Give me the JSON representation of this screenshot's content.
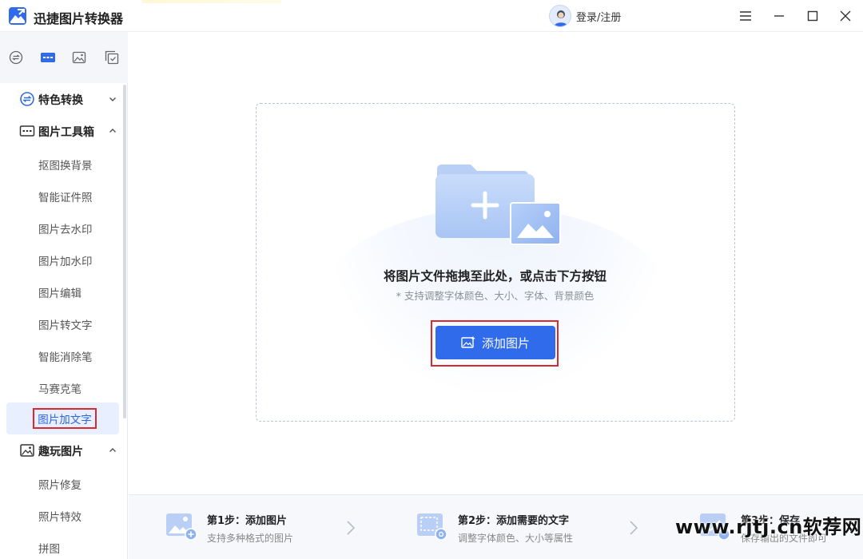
{
  "app": {
    "title": "迅捷图片转换器",
    "login_label": "登录/注册"
  },
  "sidebar": {
    "categories": [
      {
        "label": "特色转换"
      },
      {
        "label": "图片工具箱"
      },
      {
        "label": "趣玩图片"
      }
    ],
    "toolbox_items": [
      "抠图换背景",
      "智能证件照",
      "图片去水印",
      "图片加水印",
      "图片编辑",
      "图片转文字",
      "智能消除笔",
      "马赛克笔",
      "图片加文字"
    ],
    "fun_items": [
      "照片修复",
      "照片特效",
      "拼图"
    ],
    "active_item": "图片加文字"
  },
  "dropzone": {
    "title": "将图片文件拖拽至此处，或点击下方按钮",
    "subtitle": "* 支持调整字体颜色、大小、字体、背景颜色",
    "add_button": "添加图片"
  },
  "steps": [
    {
      "title": "第1步：添加图片",
      "desc": "支持多种格式的图片"
    },
    {
      "title": "第2步：添加需要的文字",
      "desc": "调整字体颜色、大小等属性"
    },
    {
      "title": "第3步：保存",
      "desc": "保存输出的文件即可"
    }
  ],
  "watermark": "www.rjtj.cn软荐网",
  "colors": {
    "accent": "#2f6bea",
    "highlight_border": "#d9282f",
    "active_bg": "#e8efff"
  }
}
